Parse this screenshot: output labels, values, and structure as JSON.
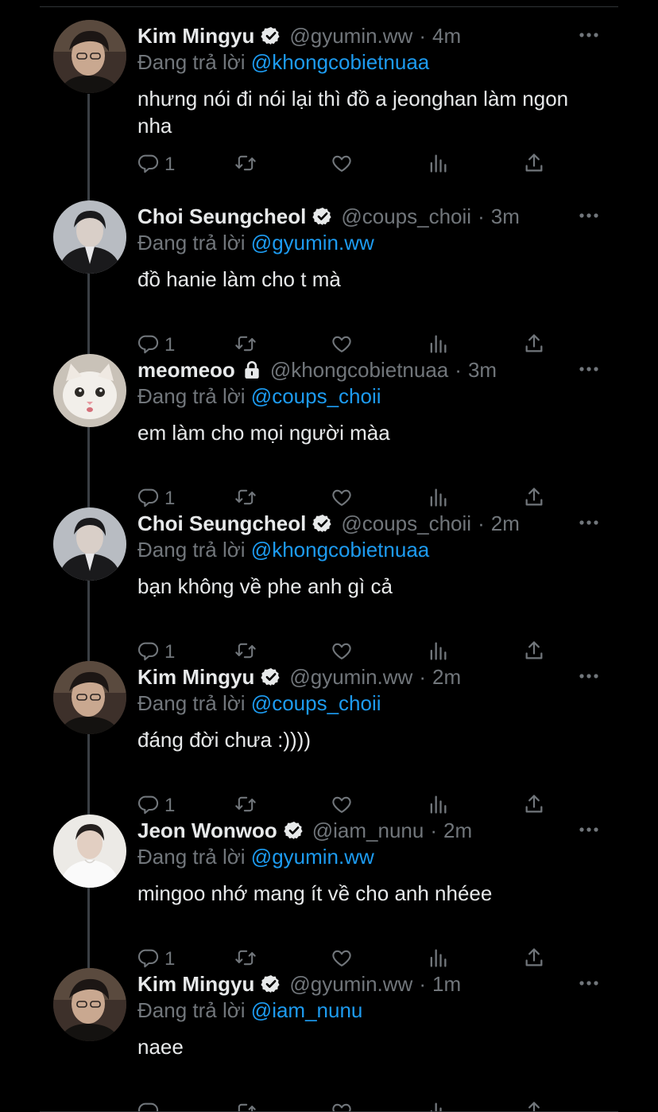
{
  "reply_prefix": "Đang trả lời",
  "tweets": [
    {
      "name": "Kim Mingyu",
      "badge": "verified",
      "handle": "@gyumin.ww",
      "time": "4m",
      "reply_to": "@khongcobietnuaa",
      "text": "nhưng nói đi nói lại thì đồ a jeonghan làm ngon nha",
      "replies": "1",
      "avatar": "mingyu"
    },
    {
      "name": "Choi Seungcheol",
      "badge": "verified",
      "handle": "@coups_choii",
      "time": "3m",
      "reply_to": "@gyumin.ww",
      "text": "đồ hanie làm cho t mà",
      "replies": "1",
      "avatar": "seungcheol"
    },
    {
      "name": "meomeoo",
      "badge": "lock",
      "handle": "@khongcobietnuaa",
      "time": "3m",
      "reply_to": "@coups_choii",
      "text": "em làm cho mọi người màa",
      "replies": "1",
      "avatar": "cat"
    },
    {
      "name": "Choi Seungcheol",
      "badge": "verified",
      "handle": "@coups_choii",
      "time": "2m",
      "reply_to": "@khongcobietnuaa",
      "text": "bạn không về phe anh gì cả",
      "replies": "1",
      "avatar": "seungcheol"
    },
    {
      "name": "Kim Mingyu",
      "badge": "verified",
      "handle": "@gyumin.ww",
      "time": "2m",
      "reply_to": "@coups_choii",
      "text": "đáng đời chưa :))))",
      "replies": "1",
      "avatar": "mingyu"
    },
    {
      "name": "Jeon Wonwoo",
      "badge": "verified",
      "handle": "@iam_nunu",
      "time": "2m",
      "reply_to": "@gyumin.ww",
      "text": "mingoo nhớ mang ít về cho anh nhéee",
      "replies": "1",
      "avatar": "wonwoo"
    },
    {
      "name": "Kim Mingyu",
      "badge": "verified",
      "handle": "@gyumin.ww",
      "time": "1m",
      "reply_to": "@iam_nunu",
      "text": "naee",
      "replies": "",
      "avatar": "mingyu"
    }
  ],
  "icons": {
    "reply": "reply-icon",
    "retweet": "retweet-icon",
    "like": "heart-icon",
    "views": "views-icon",
    "share": "share-icon",
    "more": "more-icon"
  },
  "colors": {
    "background": "#000000",
    "text": "#e7e9ea",
    "secondary": "#71767b",
    "link": "#1d9bf0"
  }
}
